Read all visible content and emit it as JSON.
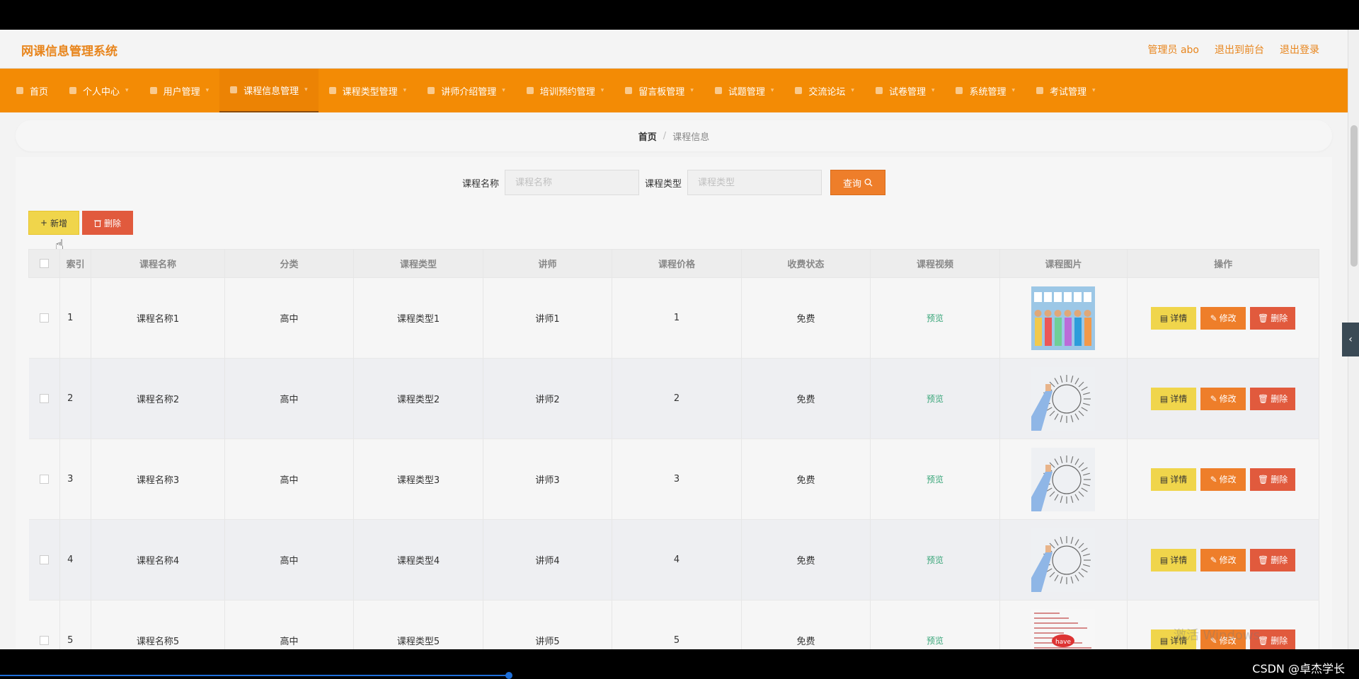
{
  "header": {
    "title": "网课信息管理系统",
    "admin": "管理员 abo",
    "to_front": "退出到前台",
    "logout": "退出登录"
  },
  "nav": [
    {
      "label": "首页",
      "icon": "home-icon"
    },
    {
      "label": "个人中心",
      "icon": "user-icon"
    },
    {
      "label": "用户管理",
      "icon": "power-icon"
    },
    {
      "label": "课程信息管理",
      "icon": "document-icon"
    },
    {
      "label": "课程类型管理",
      "icon": "clip-icon"
    },
    {
      "label": "讲师介绍管理",
      "icon": "chat-icon"
    },
    {
      "label": "培训预约管理",
      "icon": "crop-icon"
    },
    {
      "label": "留言板管理",
      "icon": "grid-icon"
    },
    {
      "label": "试题管理",
      "icon": "list-icon"
    },
    {
      "label": "交流论坛",
      "icon": "flag-icon"
    },
    {
      "label": "试卷管理",
      "icon": "chat-bubble-icon"
    },
    {
      "label": "系统管理",
      "icon": "copy-icon"
    },
    {
      "label": "考试管理",
      "icon": "chart-icon"
    }
  ],
  "breadcrumb": {
    "home": "首页",
    "sep": "/",
    "current": "课程信息"
  },
  "search": {
    "name_label": "课程名称",
    "name_placeholder": "课程名称",
    "type_label": "课程类型",
    "type_placeholder": "课程类型",
    "query_label": "查询"
  },
  "actions": {
    "add_label": "新增",
    "delete_label": "删除"
  },
  "table": {
    "headers": [
      "索引",
      "课程名称",
      "分类",
      "课程类型",
      "讲师",
      "课程价格",
      "收费状态",
      "课程视频",
      "课程图片",
      "操作"
    ],
    "rows": [
      {
        "index": "1",
        "name": "课程名称1",
        "category": "高中",
        "type": "课程类型1",
        "teacher": "讲师1",
        "price": "1",
        "status": "免费",
        "video": "预览",
        "image": "hello-image"
      },
      {
        "index": "2",
        "name": "课程名称2",
        "category": "高中",
        "type": "课程类型2",
        "teacher": "讲师2",
        "price": "2",
        "status": "免费",
        "video": "预览",
        "image": "business-training-image"
      },
      {
        "index": "3",
        "name": "课程名称3",
        "category": "高中",
        "type": "课程类型3",
        "teacher": "讲师3",
        "price": "3",
        "status": "免费",
        "video": "预览",
        "image": "business-training-image"
      },
      {
        "index": "4",
        "name": "课程名称4",
        "category": "高中",
        "type": "课程类型4",
        "teacher": "讲师4",
        "price": "4",
        "status": "免费",
        "video": "预览",
        "image": "business-training-image"
      },
      {
        "index": "5",
        "name": "课程名称5",
        "category": "高中",
        "type": "课程类型5",
        "teacher": "讲师5",
        "price": "5",
        "status": "免费",
        "video": "预览",
        "image": "have-word-cloud-image"
      }
    ],
    "op_detail": "详情",
    "op_edit": "修改",
    "op_delete": "删除"
  },
  "watermark": "激活 Windows",
  "footer_credit": "CSDN @卓杰学长",
  "colors": {
    "accent": "#f38b05",
    "logo": "#e8851c",
    "query": "#ee7e2a",
    "add": "#f0d54b",
    "delete": "#e15a3d",
    "preview": "#3aa67a"
  }
}
